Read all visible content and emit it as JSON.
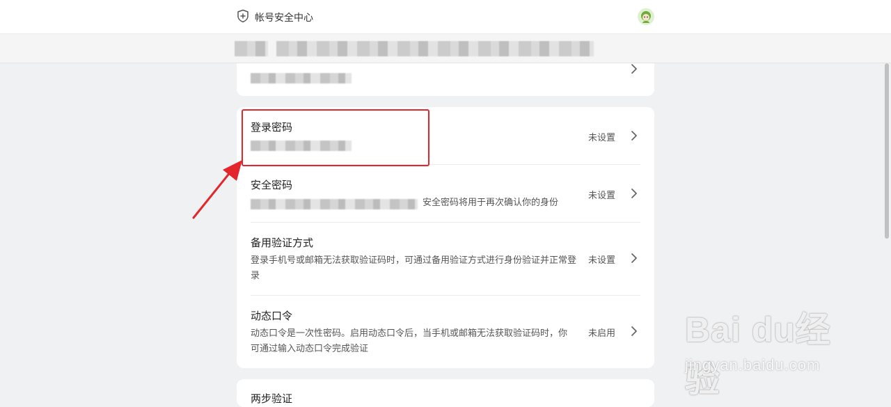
{
  "header": {
    "title": "帐号安全中心",
    "icon": "shield-plus-icon",
    "avatar_icon": "user-avatar-icon"
  },
  "settings": [
    {
      "title": "登录密码",
      "description": "",
      "status": "未设置"
    },
    {
      "title": "安全密码",
      "description": "安全密码将用于再次确认你的身份",
      "status": "未设置"
    },
    {
      "title": "备用验证方式",
      "description": "登录手机号或邮箱无法获取验证码时，可通过备用验证方式进行身份验证并正常登录",
      "status": "未设置"
    },
    {
      "title": "动态口令",
      "description": "动态口令是一次性密码。启用动态口令后，当手机或邮箱无法获取验证码时，你可通过输入动态口令完成验证",
      "status": "未启用"
    }
  ],
  "next_section": {
    "title": "两步验证"
  },
  "watermark": {
    "logo": "Bai du经验",
    "url": "jingyan.baidu.com"
  },
  "colors": {
    "highlight": "#e3262b",
    "page_bg": "#f0f1f3"
  }
}
